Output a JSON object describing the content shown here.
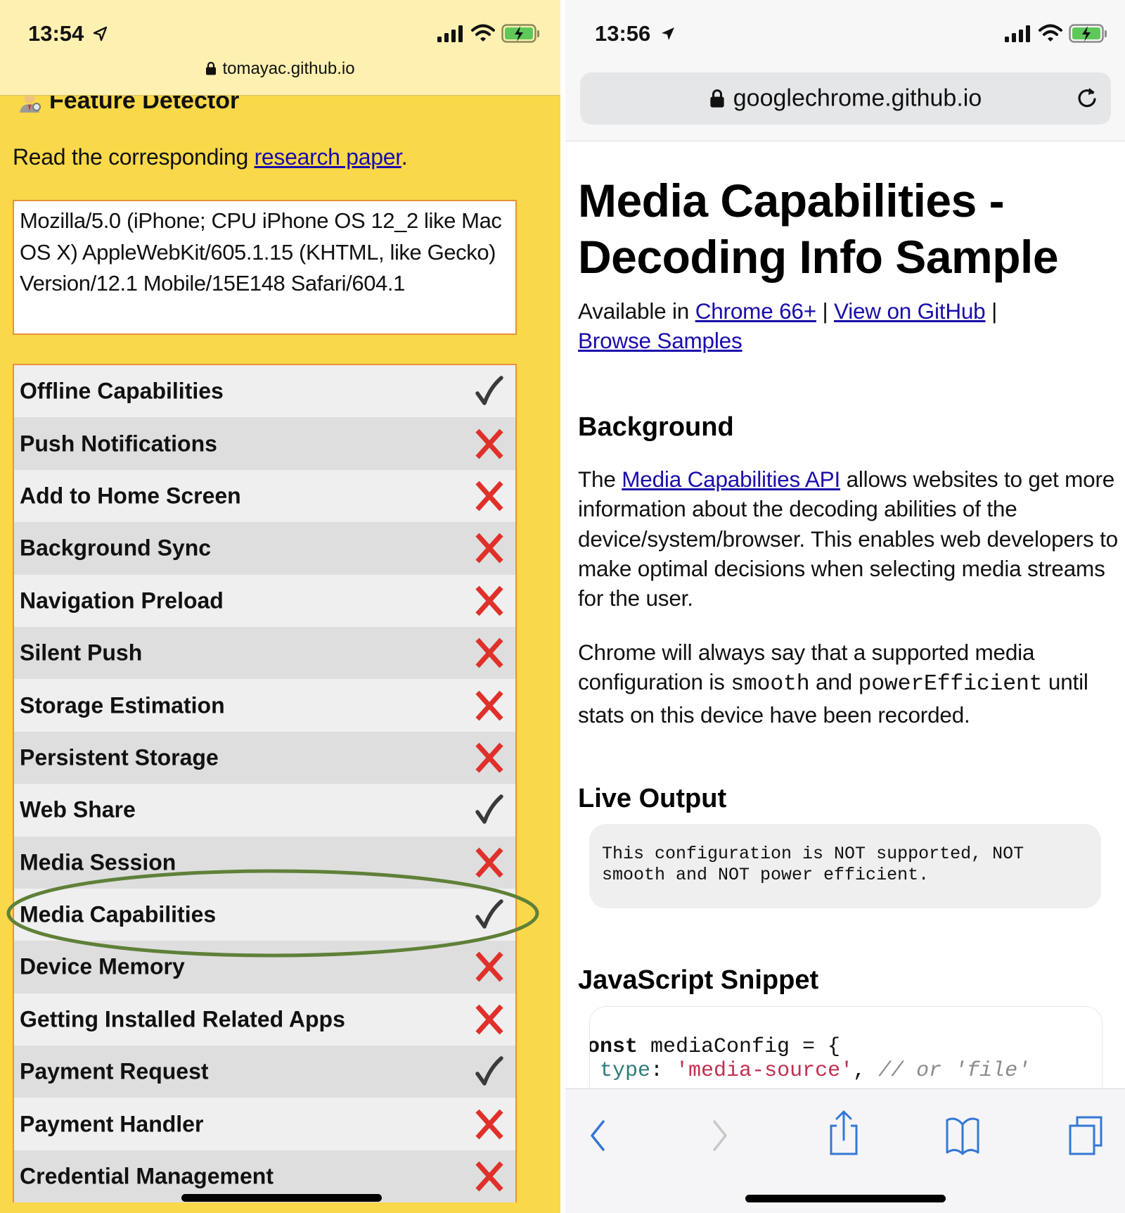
{
  "left_screen": {
    "status_bar": {
      "time": "13:54",
      "location_icon": "location-arrow-outline-icon",
      "signal_icon": "cellular-signal-icon",
      "wifi_icon": "wifi-icon",
      "battery_icon": "battery-charging-icon"
    },
    "address_bar": {
      "lock_icon": "lock-icon",
      "domain": "tomayac.github.io"
    },
    "page": {
      "header_emoji": "detective-emoji-icon",
      "title": "Feature Detector",
      "intro_prefix": "Read the corresponding ",
      "intro_link": "research paper",
      "intro_suffix": ".",
      "user_agent": "Mozilla/5.0 (iPhone; CPU iPhone OS 12_2 like Mac OS X) AppleWebKit/605.1.15 (KHTML, like Gecko) Version/12.1 Mobile/15E148 Safari/604.1",
      "features": [
        {
          "label": "Offline Capabilities",
          "supported": true
        },
        {
          "label": "Push Notifications",
          "supported": false
        },
        {
          "label": "Add to Home Screen",
          "supported": false
        },
        {
          "label": "Background Sync",
          "supported": false
        },
        {
          "label": "Navigation Preload",
          "supported": false
        },
        {
          "label": "Silent Push",
          "supported": false
        },
        {
          "label": "Storage Estimation",
          "supported": false
        },
        {
          "label": "Persistent Storage",
          "supported": false
        },
        {
          "label": "Web Share",
          "supported": true
        },
        {
          "label": "Media Session",
          "supported": false
        },
        {
          "label": "Media Capabilities",
          "supported": true,
          "highlighted": true
        },
        {
          "label": "Device Memory",
          "supported": false
        },
        {
          "label": "Getting Installed Related Apps",
          "supported": false
        },
        {
          "label": "Payment Request",
          "supported": true
        },
        {
          "label": "Payment Handler",
          "supported": false
        },
        {
          "label": "Credential Management",
          "supported": false
        }
      ]
    },
    "colors": {
      "page_bg": "#f9d84a",
      "status_bg": "#fdf0b0",
      "border": "#e9903a",
      "check": "#3a3a3a",
      "cross": "#e0302a",
      "highlight_ellipse": "#5f8038",
      "link": "#1a0dab"
    }
  },
  "right_screen": {
    "status_bar": {
      "time": "13:56",
      "location_icon": "location-arrow-filled-icon",
      "signal_icon": "cellular-signal-icon",
      "wifi_icon": "wifi-icon",
      "battery_icon": "battery-charging-icon"
    },
    "address_bar": {
      "lock_icon": "lock-icon",
      "domain": "googlechrome.github.io",
      "reload_icon": "reload-icon"
    },
    "page": {
      "title_line1": "Media Capabilities -",
      "title_line2": "Decoding Info Sample",
      "available_prefix": "Available in ",
      "link_chrome": "Chrome 66+",
      "separator": " | ",
      "link_github": "View on GitHub",
      "link_samples": "Browse Samples",
      "background_heading": "Background",
      "bg_p1_prefix": "The ",
      "bg_p1_link": "Media Capabilities API",
      "bg_p1_rest": " allows websites to get more information about the decoding abilities of the device/system/browser. This enables web developers to make optimal decisions when selecting media streams for the user.",
      "bg_p2_part1": "Chrome will always say that a supported media configuration is ",
      "bg_p2_code1": "smooth",
      "bg_p2_part2": " and ",
      "bg_p2_code2": "powerEfficient",
      "bg_p2_part3": " until stats on this device have been recorded.",
      "live_output_heading": "Live Output",
      "live_output_text": "This configuration is NOT supported, NOT\nsmooth and NOT power efficient.",
      "snippet_heading": "JavaScript Snippet",
      "code_line1": {
        "keyword": "onst",
        "rest": " mediaConfig = {"
      },
      "code_line2": {
        "indent": " ",
        "prop": "type",
        "colon": ": ",
        "string": "'media-source'",
        "comma": ", ",
        "comment": "// or 'file'"
      }
    },
    "toolbar": {
      "back": "back-chevron-icon",
      "forward": "forward-chevron-icon",
      "share": "share-icon",
      "bookmarks": "bookmarks-icon",
      "tabs": "tabs-icon"
    },
    "colors": {
      "header_bg": "#f7f7f7",
      "url_field_bg": "#e5e6e8",
      "link": "#1a0dab",
      "output_box_bg": "#efefef",
      "toolbar_icon_active": "#3478d6",
      "toolbar_icon_disabled": "#c8c8c8",
      "code_prop": "#2e7d7a",
      "code_string": "#c0304f",
      "code_comment": "#8a8a8a"
    }
  }
}
